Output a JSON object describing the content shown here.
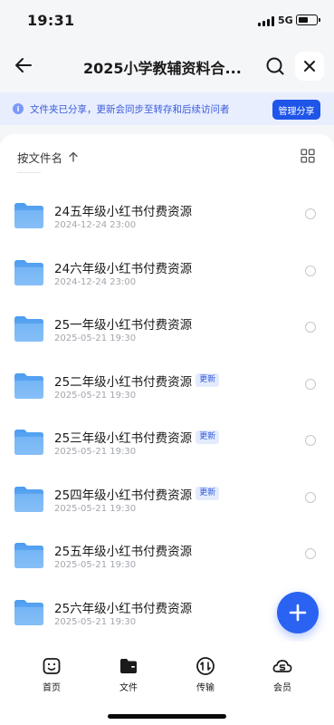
{
  "status_bar": {
    "time": "19:31",
    "network": "5G"
  },
  "header": {
    "title": "2025小学教辅资料合...",
    "back_icon": "arrow-left-icon",
    "search_icon": "search-icon",
    "close_icon": "close-icon"
  },
  "notice": {
    "text": "文件夹已分享，更新会同步至转存和后续访问者",
    "button_label": "管理分享",
    "icon": "info-icon"
  },
  "sort": {
    "label": "按文件名",
    "direction_icon": "arrow-up-icon",
    "view_icon": "grid-view-icon"
  },
  "files": [
    {
      "name": "24五年级小红书付费资源",
      "date": "2024-12-24 23:00",
      "badge": ""
    },
    {
      "name": "24六年级小红书付费资源",
      "date": "2024-12-24 23:00",
      "badge": ""
    },
    {
      "name": "25一年级小红书付费资源",
      "date": "2025-05-21 19:30",
      "badge": ""
    },
    {
      "name": "25二年级小红书付费资源",
      "date": "2025-05-21 19:30",
      "badge": "更新"
    },
    {
      "name": "25三年级小红书付费资源",
      "date": "2025-05-21 19:30",
      "badge": "更新"
    },
    {
      "name": "25四年级小红书付费资源",
      "date": "2025-05-21 19:30",
      "badge": "更新"
    },
    {
      "name": "25五年级小红书付费资源",
      "date": "2025-05-21 19:30",
      "badge": ""
    },
    {
      "name": "25六年级小红书付费资源",
      "date": "2025-05-21 19:30",
      "badge": ""
    }
  ],
  "fab": {
    "icon": "plus-icon"
  },
  "nav": [
    {
      "label": "首页",
      "icon": "home-icon"
    },
    {
      "label": "文件",
      "icon": "folder-icon"
    },
    {
      "label": "传输",
      "icon": "transfer-icon"
    },
    {
      "label": "会员",
      "icon": "vip-icon"
    }
  ],
  "colors": {
    "accent": "#1f55e8",
    "notice_bg": "#e8eefe",
    "folder": "#5fa7f3"
  }
}
